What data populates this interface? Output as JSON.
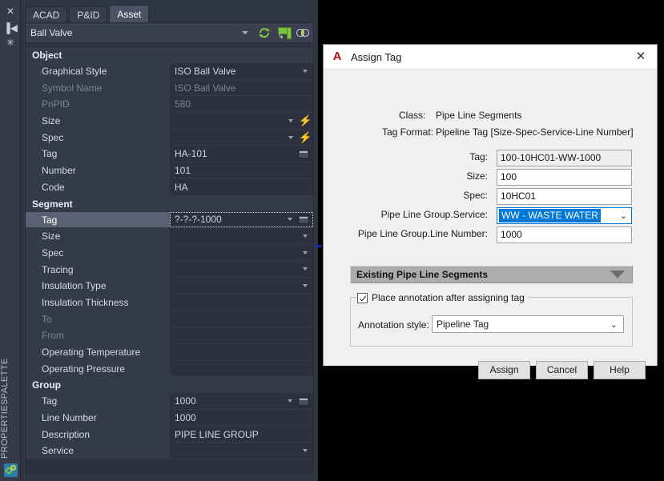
{
  "palette": {
    "vertical_title": "PROPERTIESPALETTE",
    "strip_icons": {
      "close": "✕",
      "autohide": "▐◀",
      "menu": "✳"
    },
    "tabs": [
      {
        "label": "ACAD",
        "active": false
      },
      {
        "label": "P&ID",
        "active": false
      },
      {
        "label": "Asset",
        "active": true
      }
    ],
    "selector": {
      "value": "Ball Valve",
      "icons": [
        "refresh-icon",
        "quick-select-icon",
        "toggle-rings-icon"
      ]
    },
    "groups": [
      {
        "name": "Object",
        "rows": [
          {
            "label": "Graphical Style",
            "value": "ISO Ball Valve",
            "caret": true,
            "dim": false,
            "bolt": false,
            "dialog": false,
            "selected": false
          },
          {
            "label": "Symbol Name",
            "value": "ISO Ball Valve",
            "caret": false,
            "dim": true,
            "bolt": false,
            "dialog": false,
            "selected": false
          },
          {
            "label": "PnPID",
            "value": "580",
            "caret": false,
            "dim": true,
            "bolt": false,
            "dialog": false,
            "selected": false
          },
          {
            "label": "Size",
            "value": "",
            "caret": true,
            "dim": false,
            "bolt": true,
            "dialog": false,
            "selected": false
          },
          {
            "label": "Spec",
            "value": "",
            "caret": true,
            "dim": false,
            "bolt": true,
            "dialog": false,
            "selected": false
          },
          {
            "label": "Tag",
            "value": "HA-101",
            "caret": false,
            "dim": false,
            "bolt": false,
            "dialog": true,
            "selected": false
          },
          {
            "label": "Number",
            "value": "101",
            "caret": false,
            "dim": false,
            "bolt": false,
            "dialog": false,
            "selected": false
          },
          {
            "label": "Code",
            "value": "HA",
            "caret": false,
            "dim": false,
            "bolt": false,
            "dialog": false,
            "selected": false
          }
        ]
      },
      {
        "name": "Segment",
        "rows": [
          {
            "label": "Tag",
            "value": "?-?-?-1000",
            "caret": true,
            "dim": false,
            "bolt": false,
            "dialog": true,
            "selected": true
          },
          {
            "label": "Size",
            "value": "",
            "caret": true,
            "dim": false,
            "bolt": false,
            "dialog": false,
            "selected": false
          },
          {
            "label": "Spec",
            "value": "",
            "caret": true,
            "dim": false,
            "bolt": false,
            "dialog": false,
            "selected": false
          },
          {
            "label": "Tracing",
            "value": "",
            "caret": true,
            "dim": false,
            "bolt": false,
            "dialog": false,
            "selected": false
          },
          {
            "label": "Insulation Type",
            "value": "",
            "caret": true,
            "dim": false,
            "bolt": false,
            "dialog": false,
            "selected": false
          },
          {
            "label": "Insulation Thickness",
            "value": "",
            "caret": false,
            "dim": false,
            "bolt": false,
            "dialog": false,
            "selected": false
          },
          {
            "label": "To",
            "value": "",
            "caret": false,
            "dim": true,
            "bolt": false,
            "dialog": false,
            "selected": false
          },
          {
            "label": "From",
            "value": "",
            "caret": false,
            "dim": true,
            "bolt": false,
            "dialog": false,
            "selected": false
          },
          {
            "label": "Operating Temperature",
            "value": "",
            "caret": false,
            "dim": false,
            "bolt": false,
            "dialog": false,
            "selected": false
          },
          {
            "label": "Operating Pressure",
            "value": "",
            "caret": false,
            "dim": false,
            "bolt": false,
            "dialog": false,
            "selected": false
          }
        ]
      },
      {
        "name": "Group",
        "rows": [
          {
            "label": "Tag",
            "value": "1000",
            "caret": true,
            "dim": false,
            "bolt": false,
            "dialog": true,
            "selected": false
          },
          {
            "label": "Line Number",
            "value": "1000",
            "caret": false,
            "dim": false,
            "bolt": false,
            "dialog": false,
            "selected": false
          },
          {
            "label": "Description",
            "value": "PIPE LINE GROUP",
            "caret": false,
            "dim": false,
            "bolt": false,
            "dialog": false,
            "selected": false
          },
          {
            "label": "Service",
            "value": "",
            "caret": true,
            "dim": false,
            "bolt": false,
            "dialog": false,
            "selected": false
          }
        ]
      }
    ]
  },
  "dialog": {
    "title": "Assign Tag",
    "logo_glyph": "A",
    "close_glyph": "✕",
    "info": {
      "class_label": "Class:",
      "class_value": "Pipe Line Segments",
      "format_label": "Tag Format:",
      "format_value": "Pipeline Tag [Size-Spec-Service-Line Number]"
    },
    "fields": [
      {
        "label": "Tag:",
        "value": "100-10HC01-WW-1000",
        "type": "readonly"
      },
      {
        "label": "Size:",
        "value": "100",
        "type": "text"
      },
      {
        "label": "Spec:",
        "value": "10HC01",
        "type": "text"
      },
      {
        "label": "Pipe Line Group.Service:",
        "value": "WW - WASTE WATER",
        "type": "select"
      },
      {
        "label": "Pipe Line Group.Line Number:",
        "value": "1000",
        "type": "text"
      }
    ],
    "existing_section": {
      "label": "Existing Pipe Line Segments",
      "expanded": false
    },
    "annotation": {
      "checkbox_label": "Place annotation after assigning tag",
      "checked": true,
      "style_label": "Annotation style:",
      "style_value": "Pipeline Tag"
    },
    "buttons": [
      {
        "label": "Assign"
      },
      {
        "label": "Cancel"
      },
      {
        "label": "Help"
      }
    ]
  },
  "colors": {
    "palette_bg": "#2f3542",
    "grid_label_bg": "#343a48",
    "grid_value_bg": "#2c313d",
    "group_header_bg": "#262b36",
    "selected_row": "#5b6173",
    "accent_blue": "#0078d7",
    "bolt_yellow": "#f5c518",
    "logo_red": "#b5121b",
    "green_icon": "#7ec242"
  }
}
